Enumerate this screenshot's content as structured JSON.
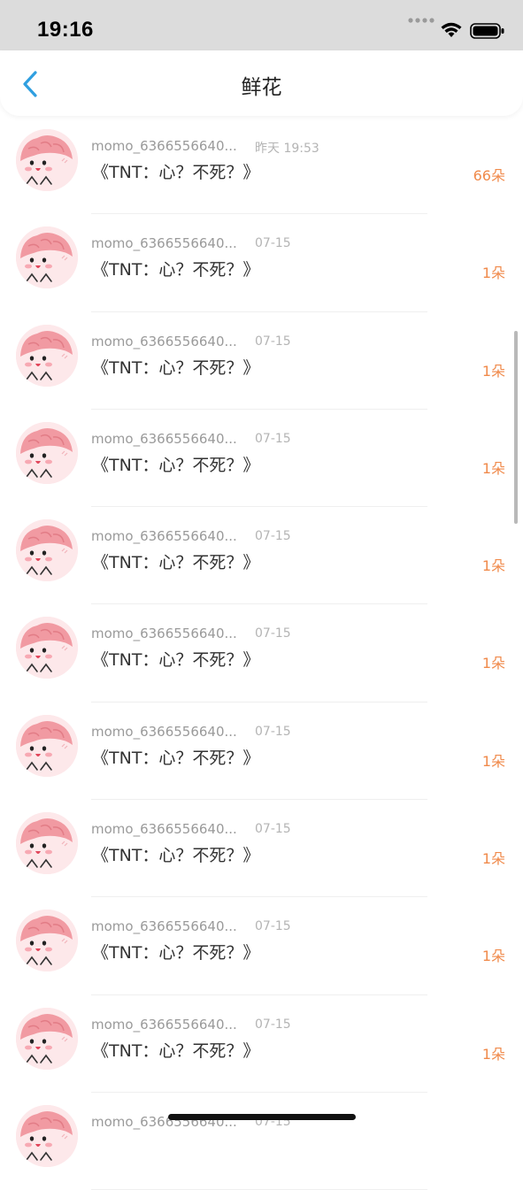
{
  "status_bar": {
    "time": "19:16"
  },
  "nav": {
    "title": "鲜花",
    "back_icon": "chevron-left-icon"
  },
  "colors": {
    "accent": "#2f9fe0",
    "count": "#f08a4b",
    "avatar_bg": "#fde8ea"
  },
  "items": [
    {
      "name": "momo_6366556640...",
      "time": "昨天 19:53",
      "message": "《TNT：心？不死？》",
      "count": "66朵"
    },
    {
      "name": "momo_6366556640...",
      "time": "07-15",
      "message": "《TNT：心？不死？》",
      "count": "1朵"
    },
    {
      "name": "momo_6366556640...",
      "time": "07-15",
      "message": "《TNT：心？不死？》",
      "count": "1朵"
    },
    {
      "name": "momo_6366556640...",
      "time": "07-15",
      "message": "《TNT：心？不死？》",
      "count": "1朵"
    },
    {
      "name": "momo_6366556640...",
      "time": "07-15",
      "message": "《TNT：心？不死？》",
      "count": "1朵"
    },
    {
      "name": "momo_6366556640...",
      "time": "07-15",
      "message": "《TNT：心？不死？》",
      "count": "1朵"
    },
    {
      "name": "momo_6366556640...",
      "time": "07-15",
      "message": "《TNT：心？不死？》",
      "count": "1朵"
    },
    {
      "name": "momo_6366556640...",
      "time": "07-15",
      "message": "《TNT：心？不死？》",
      "count": "1朵"
    },
    {
      "name": "momo_6366556640...",
      "time": "07-15",
      "message": "《TNT：心？不死？》",
      "count": "1朵"
    },
    {
      "name": "momo_6366556640...",
      "time": "07-15",
      "message": "《TNT：心？不死？》",
      "count": "1朵"
    },
    {
      "name": "momo_6366556640...",
      "time": "07-15",
      "message": "",
      "count": ""
    }
  ]
}
